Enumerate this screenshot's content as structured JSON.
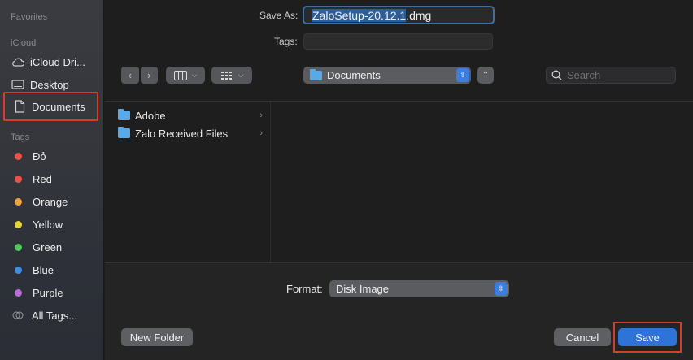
{
  "sidebar": {
    "favorites_header": "Favorites",
    "icloud_header": "iCloud",
    "tags_header": "Tags",
    "items": [
      {
        "label": "iCloud Dri...",
        "icon": "cloud-icon"
      },
      {
        "label": "Desktop",
        "icon": "desktop-icon"
      },
      {
        "label": "Documents",
        "icon": "document-icon",
        "selected": true
      }
    ],
    "tags": [
      {
        "label": "Đỏ",
        "color": "#e5534b"
      },
      {
        "label": "Red",
        "color": "#e5534b"
      },
      {
        "label": "Orange",
        "color": "#f0a33a"
      },
      {
        "label": "Yellow",
        "color": "#e8d43a"
      },
      {
        "label": "Green",
        "color": "#4dc65a"
      },
      {
        "label": "Blue",
        "color": "#3d8fe6"
      },
      {
        "label": "Purple",
        "color": "#b86ddc"
      },
      {
        "label": "All Tags...",
        "color": "#8a8a8a"
      }
    ]
  },
  "header": {
    "save_as_label": "Save As:",
    "filename_selected": "ZaloSetup-20.12.1",
    "filename_ext": ".dmg",
    "tags_label": "Tags:"
  },
  "toolbar": {
    "location": "Documents",
    "search_placeholder": "Search"
  },
  "browser": {
    "items": [
      {
        "label": "Adobe"
      },
      {
        "label": "Zalo Received Files"
      }
    ]
  },
  "footer": {
    "format_label": "Format:",
    "format_value": "Disk Image",
    "new_folder_label": "New Folder",
    "cancel_label": "Cancel",
    "save_label": "Save"
  },
  "colors": {
    "accent": "#2f73d9",
    "highlight_box": "#d2402c"
  }
}
